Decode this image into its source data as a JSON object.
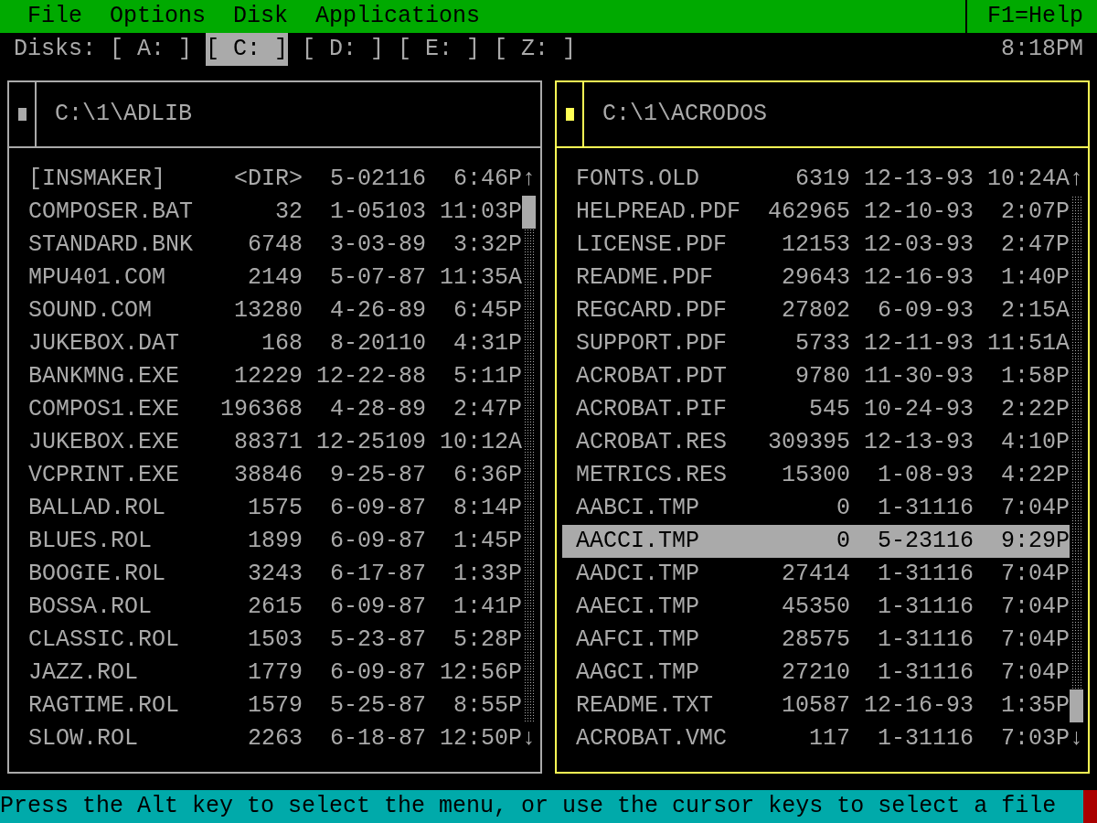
{
  "menu_bar": {
    "items": [
      "File",
      "Options",
      "Disk",
      "Applications"
    ],
    "help": "F1=Help"
  },
  "disks": {
    "label": "Disks:",
    "items": [
      {
        "label": "[ A: ]",
        "selected": false
      },
      {
        "label": "[ C: ]",
        "selected": true
      },
      {
        "label": "[ D: ]",
        "selected": false
      },
      {
        "label": "[ E: ]",
        "selected": false
      },
      {
        "label": "[ Z: ]",
        "selected": false
      }
    ],
    "clock": "8:18PM"
  },
  "panels": [
    {
      "path": "C:\\1\\ADLIB",
      "active": false,
      "scroll_up": "↑",
      "scroll_down": "↓",
      "files": [
        {
          "name": "[INSMAKER]",
          "size": "<DIR>",
          "date": "5-02116",
          "time": "6:46P",
          "selected": false
        },
        {
          "name": "COMPOSER.BAT",
          "size": "32",
          "date": "1-05103",
          "time": "11:03P",
          "selected": false
        },
        {
          "name": "STANDARD.BNK",
          "size": "6748",
          "date": "3-03-89",
          "time": "3:32P",
          "selected": false
        },
        {
          "name": "MPU401.COM",
          "size": "2149",
          "date": "5-07-87",
          "time": "11:35A",
          "selected": false
        },
        {
          "name": "SOUND.COM",
          "size": "13280",
          "date": "4-26-89",
          "time": "6:45P",
          "selected": false
        },
        {
          "name": "JUKEBOX.DAT",
          "size": "168",
          "date": "8-20110",
          "time": "4:31P",
          "selected": false
        },
        {
          "name": "BANKMNG.EXE",
          "size": "12229",
          "date": "12-22-88",
          "time": "5:11P",
          "selected": false
        },
        {
          "name": "COMPOS1.EXE",
          "size": "196368",
          "date": "4-28-89",
          "time": "2:47P",
          "selected": false
        },
        {
          "name": "JUKEBOX.EXE",
          "size": "88371",
          "date": "12-25109",
          "time": "10:12A",
          "selected": false
        },
        {
          "name": "VCPRINT.EXE",
          "size": "38846",
          "date": "9-25-87",
          "time": "6:36P",
          "selected": false
        },
        {
          "name": "BALLAD.ROL",
          "size": "1575",
          "date": "6-09-87",
          "time": "8:14P",
          "selected": false
        },
        {
          "name": "BLUES.ROL",
          "size": "1899",
          "date": "6-09-87",
          "time": "1:45P",
          "selected": false
        },
        {
          "name": "BOOGIE.ROL",
          "size": "3243",
          "date": "6-17-87",
          "time": "1:33P",
          "selected": false
        },
        {
          "name": "BOSSA.ROL",
          "size": "2615",
          "date": "6-09-87",
          "time": "1:41P",
          "selected": false
        },
        {
          "name": "CLASSIC.ROL",
          "size": "1503",
          "date": "5-23-87",
          "time": "5:28P",
          "selected": false
        },
        {
          "name": "JAZZ.ROL",
          "size": "1779",
          "date": "6-09-87",
          "time": "12:56P",
          "selected": false
        },
        {
          "name": "RAGTIME.ROL",
          "size": "1579",
          "date": "5-25-87",
          "time": "8:55P",
          "selected": false
        },
        {
          "name": "SLOW.ROL",
          "size": "2263",
          "date": "6-18-87",
          "time": "12:50P",
          "selected": false
        }
      ]
    },
    {
      "path": "C:\\1\\ACRODOS",
      "active": true,
      "scroll_up": "↑",
      "scroll_down": "↓",
      "files": [
        {
          "name": "FONTS.OLD",
          "size": "6319",
          "date": "12-13-93",
          "time": "10:24A",
          "selected": false
        },
        {
          "name": "HELPREAD.PDF",
          "size": "462965",
          "date": "12-10-93",
          "time": "2:07P",
          "selected": false
        },
        {
          "name": "LICENSE.PDF",
          "size": "12153",
          "date": "12-03-93",
          "time": "2:47P",
          "selected": false
        },
        {
          "name": "README.PDF",
          "size": "29643",
          "date": "12-16-93",
          "time": "1:40P",
          "selected": false
        },
        {
          "name": "REGCARD.PDF",
          "size": "27802",
          "date": "6-09-93",
          "time": "2:15A",
          "selected": false
        },
        {
          "name": "SUPPORT.PDF",
          "size": "5733",
          "date": "12-11-93",
          "time": "11:51A",
          "selected": false
        },
        {
          "name": "ACROBAT.PDT",
          "size": "9780",
          "date": "11-30-93",
          "time": "1:58P",
          "selected": false
        },
        {
          "name": "ACROBAT.PIF",
          "size": "545",
          "date": "10-24-93",
          "time": "2:22P",
          "selected": false
        },
        {
          "name": "ACROBAT.RES",
          "size": "309395",
          "date": "12-13-93",
          "time": "4:10P",
          "selected": false
        },
        {
          "name": "METRICS.RES",
          "size": "15300",
          "date": "1-08-93",
          "time": "4:22P",
          "selected": false
        },
        {
          "name": "AABCI.TMP",
          "size": "0",
          "date": "1-31116",
          "time": "7:04P",
          "selected": false
        },
        {
          "name": "AACCI.TMP",
          "size": "0",
          "date": "5-23116",
          "time": "9:29P",
          "selected": true
        },
        {
          "name": "AADCI.TMP",
          "size": "27414",
          "date": "1-31116",
          "time": "7:04P",
          "selected": false
        },
        {
          "name": "AAECI.TMP",
          "size": "45350",
          "date": "1-31116",
          "time": "7:04P",
          "selected": false
        },
        {
          "name": "AAFCI.TMP",
          "size": "28575",
          "date": "1-31116",
          "time": "7:04P",
          "selected": false
        },
        {
          "name": "AAGCI.TMP",
          "size": "27210",
          "date": "1-31116",
          "time": "7:04P",
          "selected": false
        },
        {
          "name": "README.TXT",
          "size": "10587",
          "date": "12-16-93",
          "time": "1:35P",
          "selected": false
        },
        {
          "name": "ACROBAT.VMC",
          "size": "117",
          "date": "1-31116",
          "time": "7:03P",
          "selected": false
        }
      ]
    }
  ],
  "status_bar": "Press the Alt key to select the menu, or use the cursor keys to select a file"
}
